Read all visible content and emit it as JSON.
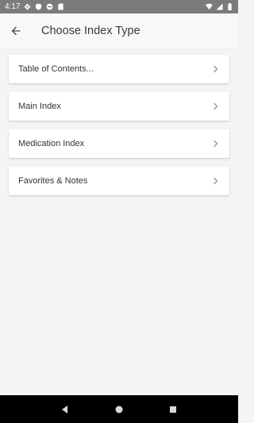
{
  "status": {
    "time": "4:17",
    "left_icons": [
      "gear-icon",
      "shield-icon",
      "no-disturb-icon",
      "sd-card-icon"
    ],
    "right_icons": [
      "wifi-icon",
      "signal-icon",
      "battery-icon"
    ]
  },
  "app_bar": {
    "title": "Choose Index Type",
    "back_icon": "arrow-left-icon"
  },
  "items": [
    {
      "label": "Table of Contents..."
    },
    {
      "label": "Main Index"
    },
    {
      "label": "Medication Index"
    },
    {
      "label": "Favorites & Notes"
    }
  ],
  "nav": {
    "buttons": [
      "back-triangle-icon",
      "home-circle-icon",
      "recents-square-icon"
    ]
  },
  "colors": {
    "status_bar": "#7b7b7b",
    "background": "#f4f4f6",
    "card": "#ffffff",
    "nav_bar": "#000000"
  }
}
